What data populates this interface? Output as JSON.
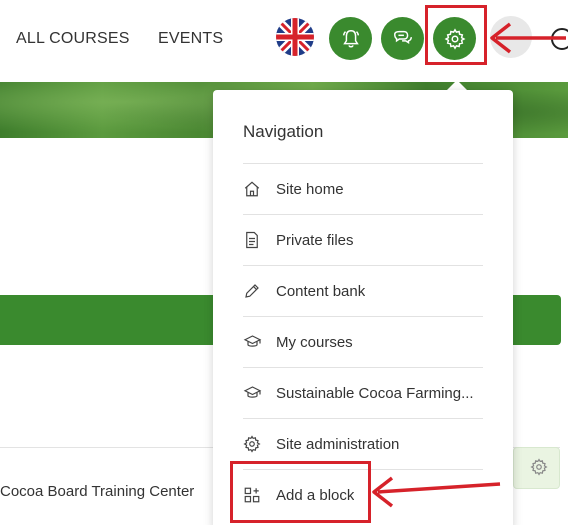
{
  "header": {
    "nav": [
      "ALL COURSES",
      "EVENTS"
    ],
    "icons": [
      "uk-flag-icon",
      "bell-icon",
      "chat-icon",
      "gear-icon",
      "avatar",
      "search-icon"
    ]
  },
  "menu": {
    "title": "Navigation",
    "items": [
      {
        "label": "Site home",
        "icon": "home-icon"
      },
      {
        "label": "Private files",
        "icon": "file-icon"
      },
      {
        "label": "Content bank",
        "icon": "pencil-icon"
      },
      {
        "label": "My courses",
        "icon": "graduation-cap-icon"
      },
      {
        "label": "Sustainable Cocoa Farming...",
        "icon": "graduation-cap-icon"
      },
      {
        "label": "Site administration",
        "icon": "gear-icon"
      },
      {
        "label": "Add a block",
        "icon": "add-block-icon"
      }
    ]
  },
  "page": {
    "board_label": "Cocoa Board Training Center"
  },
  "colors": {
    "brand_green": "#3a8a2e",
    "annotation_red": "#d6222a"
  }
}
